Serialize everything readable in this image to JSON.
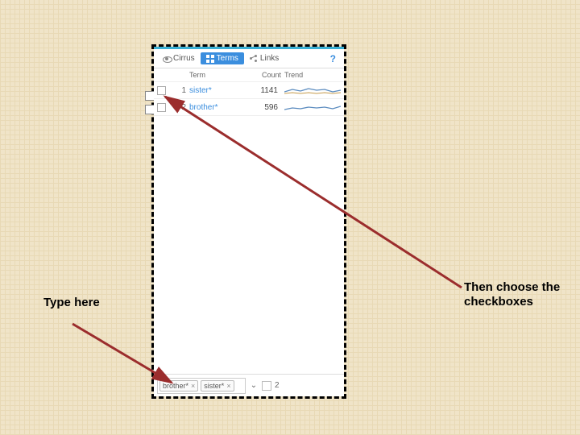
{
  "tabs": {
    "cirrus": "Cirrus",
    "terms": "Terms",
    "links": "Links",
    "help": "?"
  },
  "columns": {
    "term": "Term",
    "count": "Count",
    "trend": "Trend"
  },
  "rows": [
    {
      "idx": "1",
      "term": "sister*",
      "count": "1141"
    },
    {
      "idx": "2",
      "term": "brother*",
      "count": "596"
    }
  ],
  "toolbar": {
    "token1": "brother*",
    "token2": "sister*",
    "close": "×",
    "dropdown": "⌄",
    "count": "2"
  },
  "annotations": {
    "left": "Type here",
    "right": "Then choose the checkboxes"
  }
}
